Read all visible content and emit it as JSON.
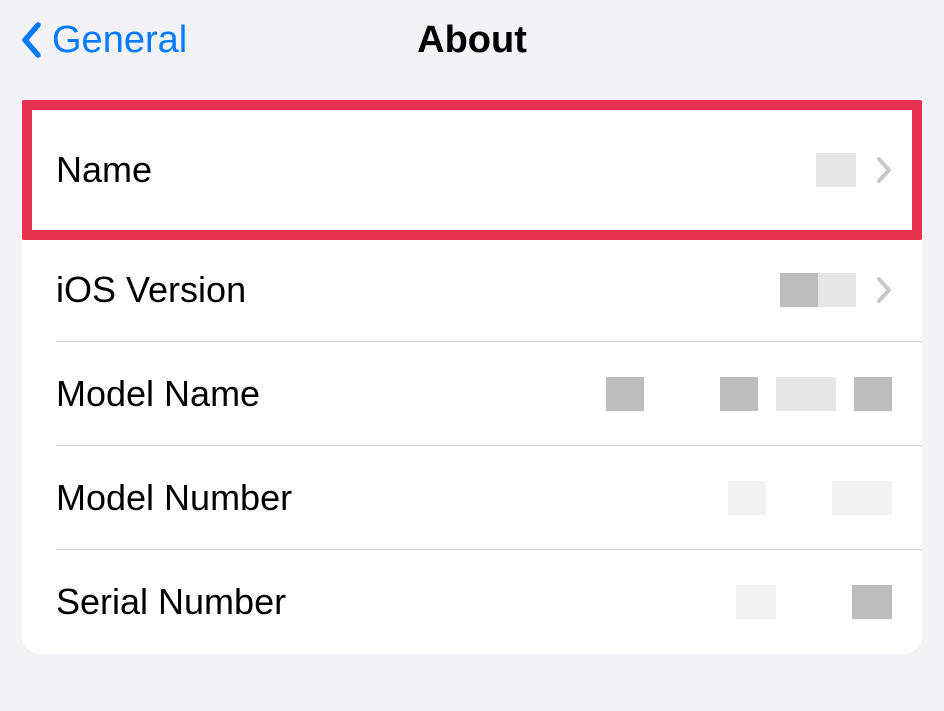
{
  "header": {
    "back_label": "General",
    "title": "About"
  },
  "rows": {
    "name": {
      "label": "Name"
    },
    "ios_version": {
      "label": "iOS Version"
    },
    "model_name": {
      "label": "Model Name"
    },
    "model_number": {
      "label": "Model Number"
    },
    "serial_number": {
      "label": "Serial Number"
    }
  }
}
